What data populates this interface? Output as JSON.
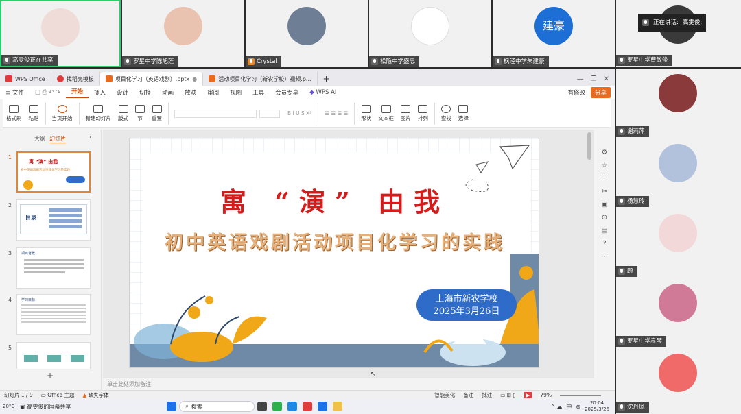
{
  "participants_top": [
    {
      "name": "高雯俊正在共享",
      "bg": "#f3e7e7",
      "color": "#e8d6d0"
    },
    {
      "name": "罗星中学陈旭莲",
      "bg": "#f1f1f1",
      "color": "#e6b9a8"
    },
    {
      "name": "Crystal",
      "bg": "#f1f1f1",
      "color": "#7a8aa0"
    },
    {
      "name": "松隐中学盛忠",
      "bg": "#f1f1f1",
      "color": "#ffffff"
    },
    {
      "name": "枫泾中学朱建豪",
      "bg": "#f1f1f1",
      "color": "#1d6fd6",
      "avatar_text": "建豪"
    }
  ],
  "speaking": {
    "label": "正在讲话:",
    "name": "高雯俊;"
  },
  "participants_right": [
    {
      "name": "罗星中学曹敏俊",
      "color": "#3a3a3a"
    },
    {
      "name": "谢莉萍",
      "color": "#7a2a2a"
    },
    {
      "name": "杨慧玲",
      "color": "#a8b8d8"
    },
    {
      "name": "顾",
      "color": "#e8c8c8"
    },
    {
      "name": "罗星中学袁琴",
      "color": "#c86890"
    },
    {
      "name": "沈丹凤",
      "color": "#e85a5a"
    }
  ],
  "tabs": [
    {
      "label": "WPS Office",
      "icon_color": "#e23b3b"
    },
    {
      "label": "找稻壳模板",
      "icon_color": "#e23b3b"
    },
    {
      "label": "项目化学习（英语戏剧）.pptx",
      "icon_color": "#e86b1f",
      "active": true
    },
    {
      "label": "活动项目化学习（新农学校）视频.p...",
      "icon_color": "#e86b1f"
    }
  ],
  "menus": [
    "文件",
    "开始",
    "插入",
    "设计",
    "切换",
    "动画",
    "放映",
    "审阅",
    "视图",
    "工具",
    "会员专享",
    "WPS AI"
  ],
  "menu_right": {
    "modify": "有修改",
    "share": "分享"
  },
  "ribbon": [
    "格式刷",
    "粘贴",
    "当页开始",
    "新建幻灯片",
    "版式",
    "节",
    "重置",
    "形状",
    "文本框",
    "图片",
    "排列",
    "查找",
    "选择"
  ],
  "panel_tabs": {
    "outline": "大纲",
    "slides": "幻灯片"
  },
  "slide": {
    "title": "寓 “演” 由我",
    "subtitle": "初中英语戏剧活动项目化学习的实践",
    "school": "上海市新农学校",
    "date": "2025年3月26日"
  },
  "thumb2_title": "目录",
  "thumb3_title": "项目背景",
  "thumb4_title": "学习目标",
  "notes_placeholder": "单击此处添加备注",
  "status": {
    "slide": "幻灯片 1 / 9",
    "theme": "Office 主题",
    "font": "缺失字体",
    "beautify": "智能美化",
    "notes": "备注",
    "comment": "批注",
    "zoom": "79%"
  },
  "taskbar": {
    "share": "高雯俊的屏幕共享",
    "search": "搜索",
    "ime": "中",
    "time": "20:04",
    "date": "2025/3/26",
    "weather": "20°C"
  }
}
